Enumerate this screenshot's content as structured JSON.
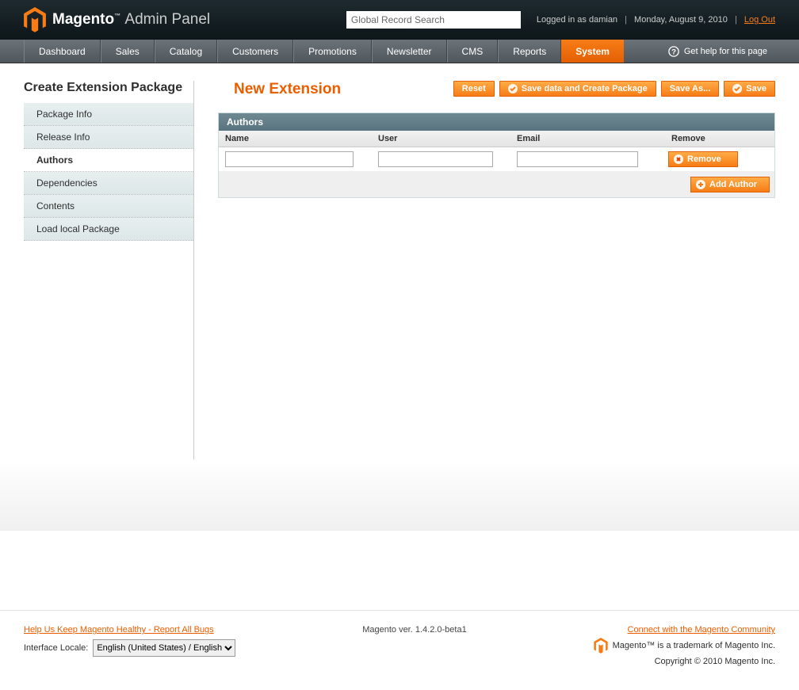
{
  "header": {
    "brand_main": "Magento",
    "brand_sub": "Admin Panel",
    "search_placeholder": "Global Record Search",
    "logged_in": "Logged in as damian",
    "date": "Monday, August 9, 2010",
    "logout": "Log Out"
  },
  "nav": {
    "items": [
      "Dashboard",
      "Sales",
      "Catalog",
      "Customers",
      "Promotions",
      "Newsletter",
      "CMS",
      "Reports",
      "System"
    ],
    "active_index": 8,
    "help": "Get help for this page"
  },
  "sidebar": {
    "title": "Create Extension Package",
    "tabs": [
      "Package Info",
      "Release Info",
      "Authors",
      "Dependencies",
      "Contents",
      "Load local Package"
    ],
    "active_index": 2
  },
  "page": {
    "title": "New Extension",
    "buttons": {
      "reset": "Reset",
      "save_create": "Save data and Create Package",
      "save_as": "Save As...",
      "save": "Save"
    }
  },
  "panel": {
    "title": "Authors",
    "columns": {
      "name": "Name",
      "user": "User",
      "email": "Email",
      "remove": "Remove"
    },
    "row": {
      "name": "",
      "user": "",
      "email": ""
    },
    "remove_btn": "Remove",
    "add_btn": "Add Author"
  },
  "footer": {
    "bugs": "Help Us Keep Magento Healthy - Report All Bugs",
    "locale_label": "Interface Locale:",
    "locale_value": "English (United States) / English",
    "version": "Magento ver. 1.4.2.0-beta1",
    "community": "Connect with the Magento Community",
    "trademark": "Magento™ is a trademark of Magento Inc.",
    "copyright": "Copyright © 2010 Magento Inc."
  }
}
